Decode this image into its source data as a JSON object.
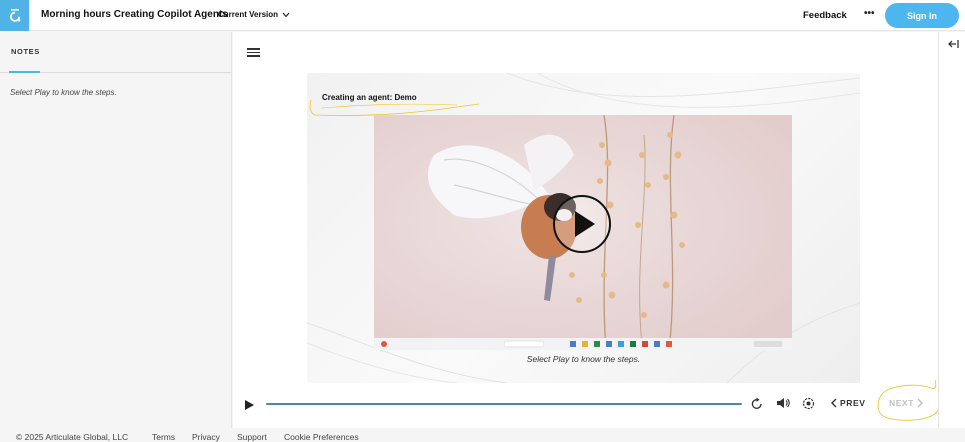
{
  "header": {
    "logo_icon": "articulate-logo-icon",
    "title": "Morning hours Creating Copilot Agents",
    "version_label": "Current Version",
    "feedback_label": "Feedback",
    "more_label": "•••",
    "signin_label": "Sign In",
    "brand_color": "#4db6ef"
  },
  "notes": {
    "tab_label": "NOTES",
    "body_text": "Select Play to know the steps."
  },
  "slide": {
    "title": "Creating an agent: Demo",
    "caption": "Select Play to know the steps."
  },
  "controls": {
    "prev_label": "PREV",
    "next_label": "NEXT",
    "icons": [
      "play-icon",
      "replay-icon",
      "volume-icon",
      "settings-icon"
    ]
  },
  "footer": {
    "copyright": "© 2025 Articulate Global, LLC",
    "links": [
      "Terms",
      "Privacy",
      "Support",
      "Cookie Preferences"
    ]
  }
}
